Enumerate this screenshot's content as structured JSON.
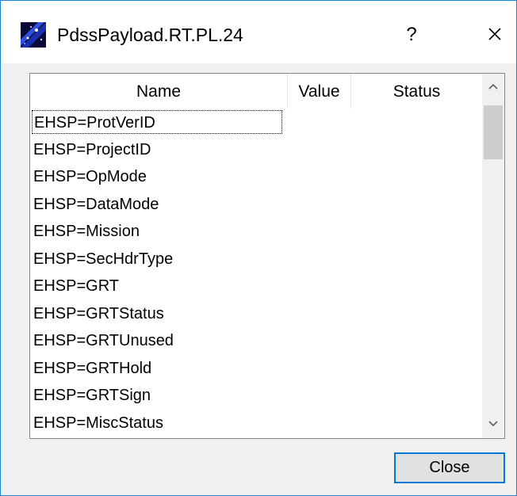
{
  "window": {
    "title": "PdssPayload.RT.PL.24",
    "help_label": "?",
    "accent_color": "#0078d7"
  },
  "table": {
    "columns": [
      "Name",
      "Value",
      "Status"
    ],
    "rows": [
      {
        "name": "EHSP=ProtVerID",
        "value": "",
        "status": ""
      },
      {
        "name": "EHSP=ProjectID",
        "value": "",
        "status": ""
      },
      {
        "name": "EHSP=OpMode",
        "value": "",
        "status": ""
      },
      {
        "name": "EHSP=DataMode",
        "value": "",
        "status": ""
      },
      {
        "name": "EHSP=Mission",
        "value": "",
        "status": ""
      },
      {
        "name": "EHSP=SecHdrType",
        "value": "",
        "status": ""
      },
      {
        "name": "EHSP=GRT",
        "value": "",
        "status": ""
      },
      {
        "name": "EHSP=GRTStatus",
        "value": "",
        "status": ""
      },
      {
        "name": "EHSP=GRTUnused",
        "value": "",
        "status": ""
      },
      {
        "name": "EHSP=GRTHold",
        "value": "",
        "status": ""
      },
      {
        "name": "EHSP=GRTSign",
        "value": "",
        "status": ""
      },
      {
        "name": "EHSP=MiscStatus",
        "value": "",
        "status": ""
      }
    ],
    "focused_row": 0
  },
  "buttons": {
    "close_label": "Close"
  }
}
